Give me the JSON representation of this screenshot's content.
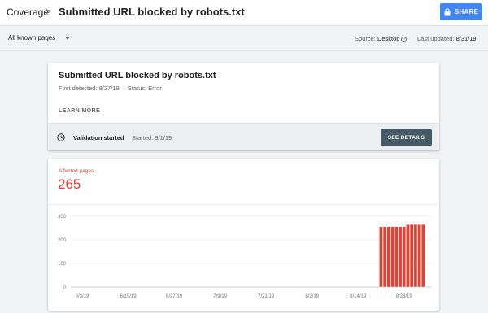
{
  "header": {
    "breadcrumb_root": "Coverage",
    "breadcrumb_separator": ">",
    "title": "Submitted URL blocked by robots.txt",
    "share_label": "SHARE",
    "share_icon": "lock-icon"
  },
  "filters": {
    "dropdown_value": "All known pages",
    "source_label": "Source:",
    "source_value": "Desktop",
    "updated_label": "Last updated:",
    "updated_value": "8/31/19"
  },
  "issue": {
    "title": "Submitted URL blocked by robots.txt",
    "first_detected": "First detected: 8/27/19",
    "status": "Status: Error",
    "learn_more": "LEARN MORE",
    "validation_label": "Validation started",
    "validation_started": "Started: 9/1/19",
    "details_label": "SEE DETAILS"
  },
  "summary": {
    "affected_label": "Affected pages",
    "affected_value": "265"
  },
  "colors": {
    "accent": "#4285f4",
    "error": "#db4437",
    "details_button": "#455a64"
  },
  "chart_data": {
    "type": "bar",
    "ylim": [
      0,
      300
    ],
    "yticks": [
      0,
      100,
      200,
      300
    ],
    "xticks": [
      "6/3/19",
      "6/15/19",
      "6/27/19",
      "7/9/19",
      "7/21/19",
      "8/2/19",
      "8/14/19",
      "8/26/19"
    ],
    "start_date": "6/3/19",
    "x": [
      "8/20/19",
      "8/21/19",
      "8/22/19",
      "8/23/19",
      "8/24/19",
      "8/25/19",
      "8/26/19",
      "8/27/19",
      "8/28/19",
      "8/29/19",
      "8/30/19",
      "8/31/19"
    ],
    "values": [
      256,
      256,
      256,
      256,
      256,
      256,
      256,
      265,
      265,
      265,
      265,
      265
    ],
    "series": [
      {
        "values": [
          256,
          256,
          256,
          256,
          256,
          256,
          256,
          265,
          265,
          265,
          265,
          265
        ]
      }
    ],
    "grid": true
  }
}
